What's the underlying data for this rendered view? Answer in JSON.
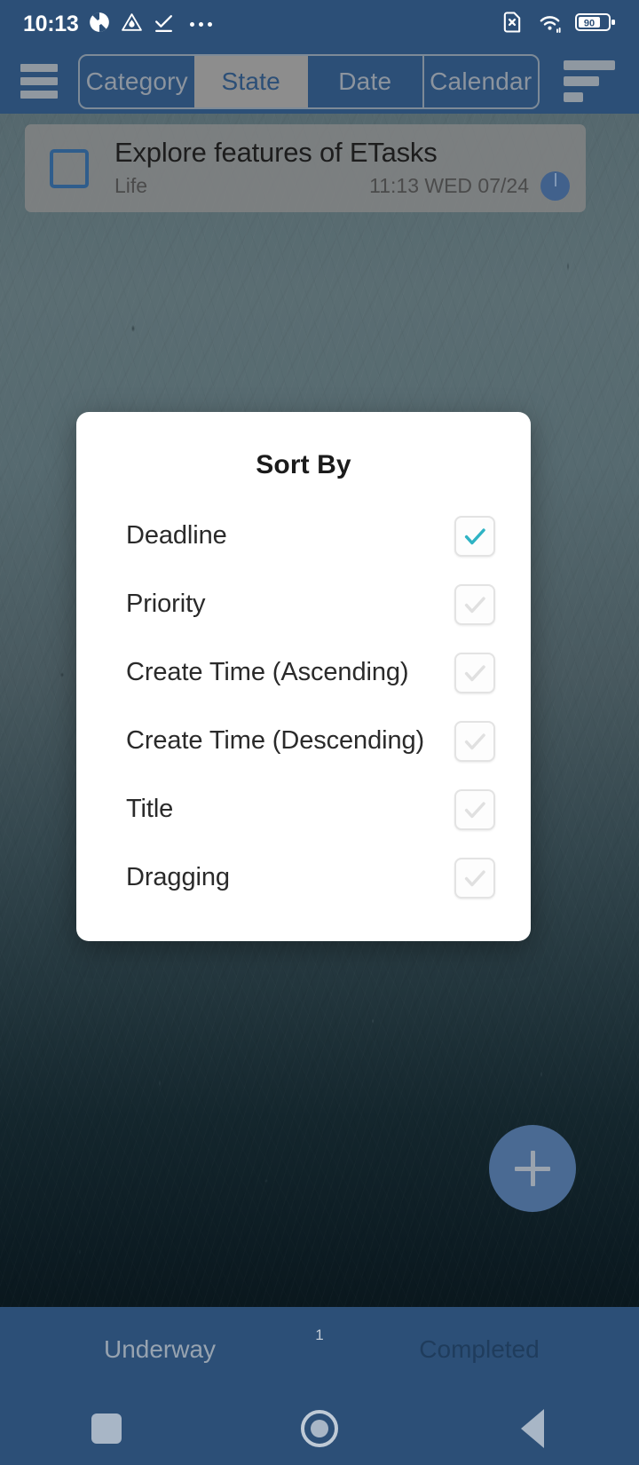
{
  "status_bar": {
    "clock": "10:13",
    "left_icons": [
      "sync-icon",
      "triangle-warning-icon",
      "check-download-icon",
      "more-dots-icon"
    ],
    "right_icons": [
      "sim-card-off-icon",
      "wifi-icon",
      "battery-icon"
    ],
    "battery_level": "90"
  },
  "app_bar": {
    "menu_icon": "hamburger-menu-icon",
    "sort_icon": "sort-bars-icon",
    "tabs": [
      {
        "label": "Category",
        "selected": false
      },
      {
        "label": "State",
        "selected": true
      },
      {
        "label": "Date",
        "selected": false
      },
      {
        "label": "Calendar",
        "selected": false
      }
    ]
  },
  "task_card": {
    "checkbox_checked": false,
    "title": "Explore features of ETasks",
    "category": "Life",
    "due": "11:13 WED 07/24",
    "progress_indicator": "pie-progress-icon"
  },
  "sort_dialog": {
    "title": "Sort By",
    "options": [
      {
        "label": "Deadline",
        "checked": true
      },
      {
        "label": "Priority",
        "checked": false
      },
      {
        "label": "Create Time (Ascending)",
        "checked": false
      },
      {
        "label": "Create Time (Descending)",
        "checked": false
      },
      {
        "label": "Title",
        "checked": false
      },
      {
        "label": "Dragging",
        "checked": false
      }
    ],
    "check_color": "#2fb3c4",
    "uncheck_color": "#e0e0e0"
  },
  "fab": {
    "icon": "plus-icon",
    "label": "+"
  },
  "bottom_bar": {
    "tabs": [
      {
        "label": "Underway",
        "active": true
      },
      {
        "label": "Completed",
        "active": false
      }
    ],
    "badge_count": "1",
    "nav": [
      {
        "name": "recent-apps",
        "icon": "square-icon"
      },
      {
        "name": "home",
        "icon": "circle-icon"
      },
      {
        "name": "back",
        "icon": "triangle-back-icon"
      }
    ]
  },
  "colors": {
    "chrome": "#2c4f77",
    "accent": "#2fb3c4",
    "fab": "#4a6a93"
  }
}
